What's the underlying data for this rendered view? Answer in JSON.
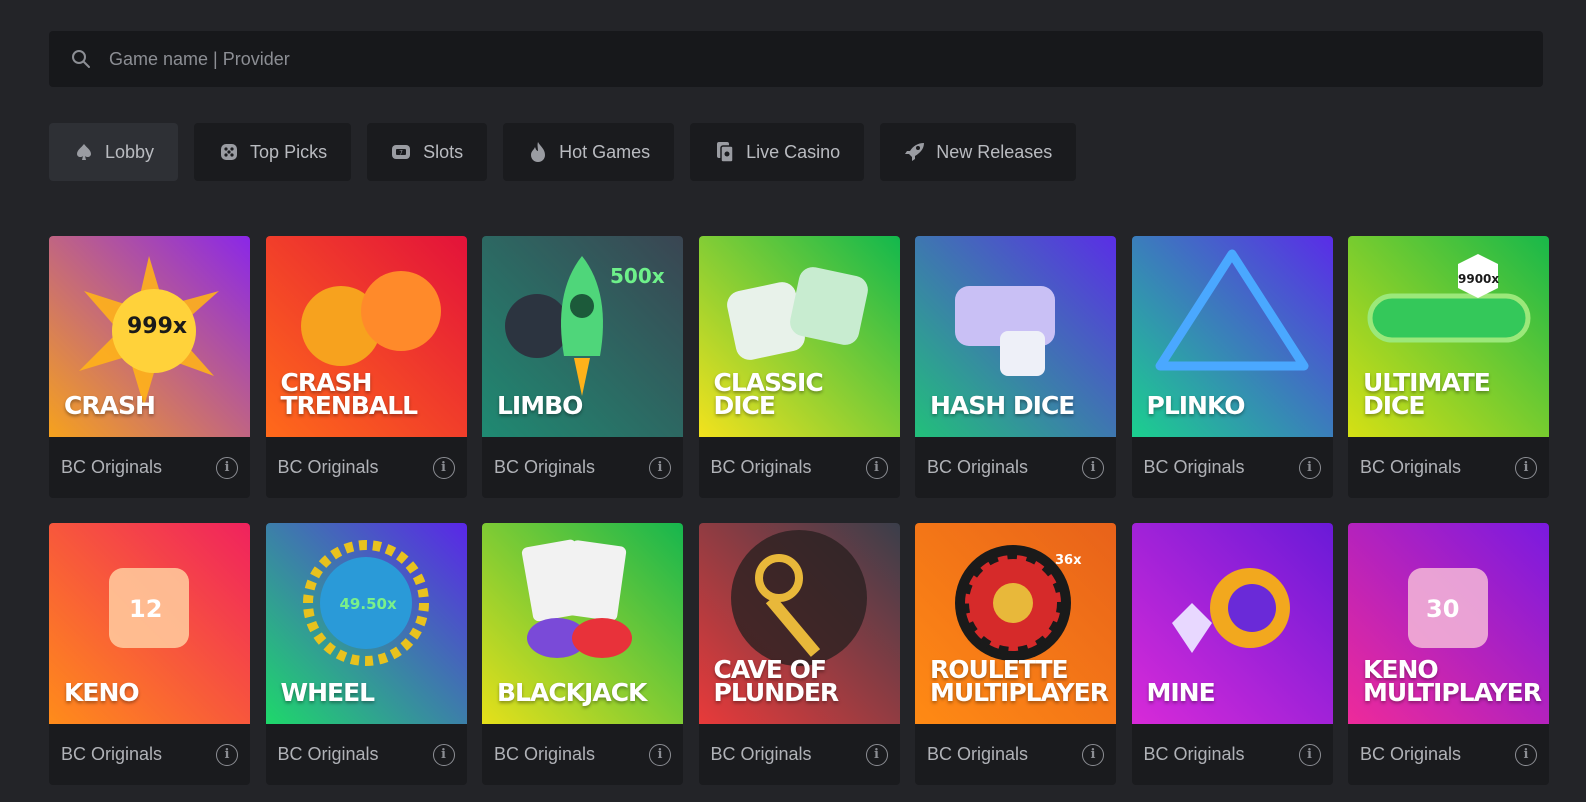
{
  "search": {
    "placeholder": "Game name | Provider",
    "value": ""
  },
  "tabs": [
    {
      "label": "Lobby",
      "icon": "spade-icon",
      "active": true
    },
    {
      "label": "Top Picks",
      "icon": "dice-icon",
      "active": false
    },
    {
      "label": "Slots",
      "icon": "slot-machine-icon",
      "active": false
    },
    {
      "label": "Hot Games",
      "icon": "flame-icon",
      "active": false
    },
    {
      "label": "Live Casino",
      "icon": "cards-icon",
      "active": false
    },
    {
      "label": "New Releases",
      "icon": "rocket-icon",
      "active": false
    }
  ],
  "games": [
    {
      "title": "CRASH",
      "provider": "BC Originals",
      "gradient": [
        "#f6a21d",
        "#8a27e8"
      ],
      "badge": "999x"
    },
    {
      "title": "CRASH\nTRENBALL",
      "provider": "BC Originals",
      "gradient": [
        "#ff6a1a",
        "#e3123a"
      ],
      "badge": ""
    },
    {
      "title": "LIMBO",
      "provider": "BC Originals",
      "gradient": [
        "#1f8a72",
        "#3a4552"
      ],
      "badge": "500x"
    },
    {
      "title": "CLASSIC DICE",
      "provider": "BC Originals",
      "gradient": [
        "#f3e21d",
        "#12b84d"
      ],
      "badge": ""
    },
    {
      "title": "HASH DICE",
      "provider": "BC Originals",
      "gradient": [
        "#22c07a",
        "#5a2ee6"
      ],
      "badge": ""
    },
    {
      "title": "PLINKO",
      "provider": "BC Originals",
      "gradient": [
        "#1bd08e",
        "#5a2ce8"
      ],
      "badge": ""
    },
    {
      "title": "ULTIMATE\nDICE",
      "provider": "BC Originals",
      "gradient": [
        "#d6e014",
        "#18b84a"
      ],
      "badge": "9900x"
    },
    {
      "title": "KENO",
      "provider": "BC Originals",
      "gradient": [
        "#ff8c1a",
        "#f0225e"
      ],
      "badge": "12"
    },
    {
      "title": "WHEEL",
      "provider": "BC Originals",
      "gradient": [
        "#1ed86a",
        "#5a26e8"
      ],
      "badge": "49.50x"
    },
    {
      "title": "BLACKJACK",
      "provider": "BC Originals",
      "gradient": [
        "#e6e01a",
        "#16b64e"
      ],
      "badge": ""
    },
    {
      "title": "CAVE OF\nPLUNDER",
      "provider": "BC Originals",
      "gradient": [
        "#e83a3a",
        "#3a3e4a"
      ],
      "badge": ""
    },
    {
      "title": "ROULETTE\nMULTIPLAYER",
      "provider": "BC Originals",
      "gradient": [
        "#ff8a14",
        "#e8621a"
      ],
      "badge": "36x"
    },
    {
      "title": "MINE",
      "provider": "BC Originals",
      "gradient": [
        "#d82ad8",
        "#6a1ad8"
      ],
      "badge": ""
    },
    {
      "title": "KENO\nMULTIPLAYER",
      "provider": "BC Originals",
      "gradient": [
        "#ee2a9a",
        "#7a1ae0"
      ],
      "badge": "30"
    }
  ]
}
